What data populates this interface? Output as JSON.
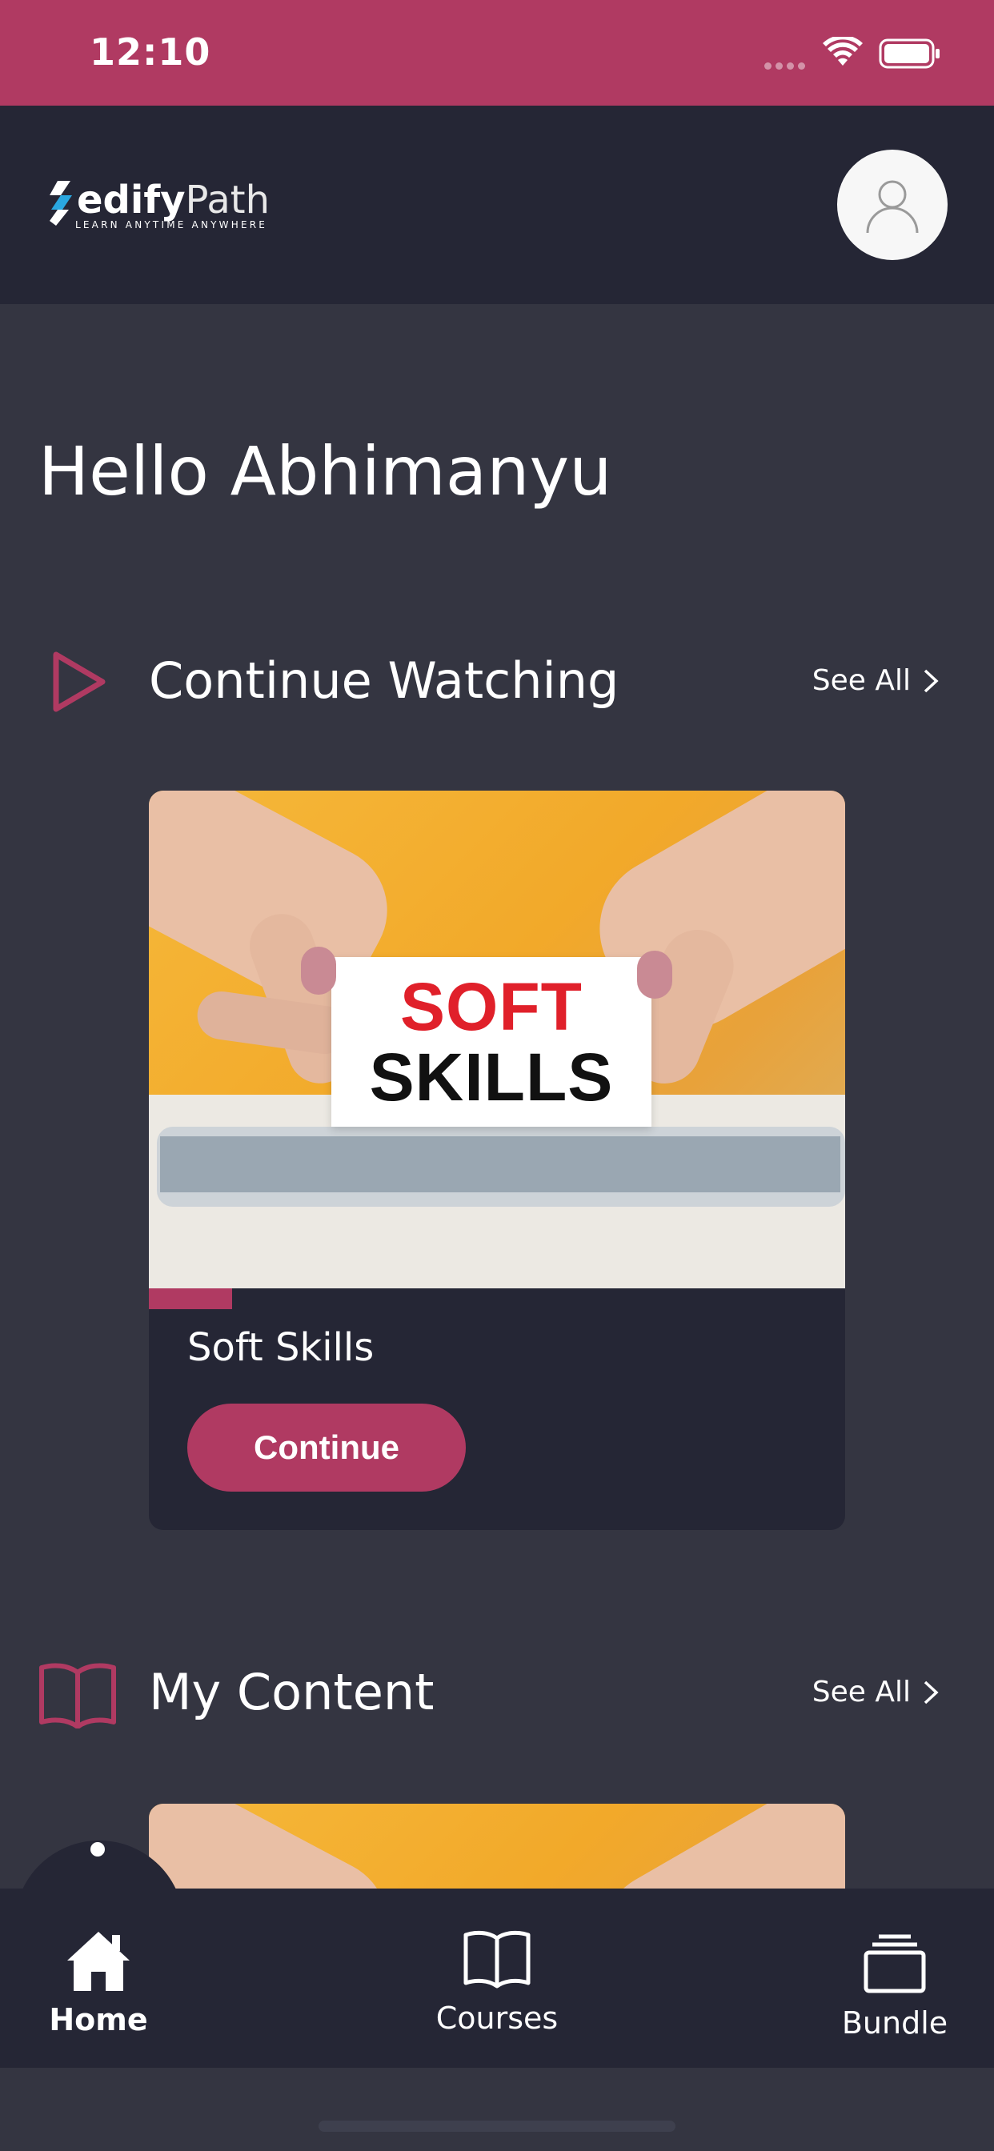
{
  "status_bar": {
    "time": "12:10"
  },
  "header": {
    "logo_bold": "edify",
    "logo_light": "Path",
    "logo_tagline": "LEARN ANYTIME ANYWHERE",
    "avatar_icon": "user-icon"
  },
  "greeting": "Hello Abhimanyu",
  "continue_watching": {
    "title": "Continue Watching",
    "icon": "play-icon",
    "see_all": "See All",
    "card": {
      "image_text_line1": "SOFT",
      "image_text_line2": "SKILLS",
      "title": "Soft Skills",
      "progress": 0.12,
      "button_label": "Continue"
    }
  },
  "my_content": {
    "title": "My Content",
    "icon": "book-icon",
    "see_all": "See All"
  },
  "bottom_nav": {
    "items": [
      {
        "label": "Home",
        "icon": "home-icon",
        "active": true
      },
      {
        "label": "Courses",
        "icon": "book-icon",
        "active": false
      },
      {
        "label": "Bundle",
        "icon": "stack-icon",
        "active": false
      }
    ]
  },
  "colors": {
    "accent": "#b03a62",
    "background": "#343541",
    "surface": "#252635"
  }
}
